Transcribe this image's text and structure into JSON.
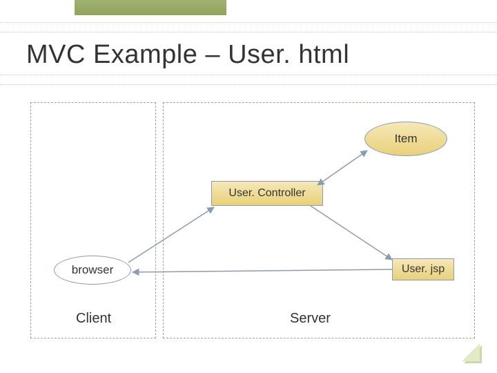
{
  "title": "MVC Example – User. html",
  "nodes": {
    "item": "Item",
    "controller": "User. Controller",
    "browser": "browser",
    "userjsp": "User. jsp"
  },
  "zones": {
    "client": "Client",
    "server": "Server"
  }
}
